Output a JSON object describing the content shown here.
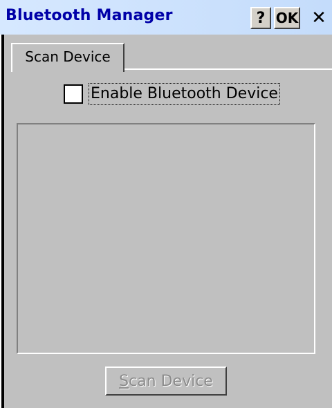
{
  "window": {
    "title": "Bluetooth Manager",
    "help_label": "?",
    "ok_label": "OK",
    "close_label": "✕"
  },
  "tabs": [
    {
      "label": "Scan Device",
      "selected": true
    }
  ],
  "panel": {
    "enable_checkbox": {
      "label": "Enable Bluetooth Device",
      "checked": false
    },
    "device_list": {
      "items": []
    },
    "scan_button": {
      "label_first": "S",
      "label_rest": "can Device",
      "enabled": false
    }
  },
  "colors": {
    "titlebar": "#c4dcfb",
    "title_text": "#0000a8",
    "panel_bg": "#c0c0c0",
    "disabled_text": "#8c8c8c"
  }
}
